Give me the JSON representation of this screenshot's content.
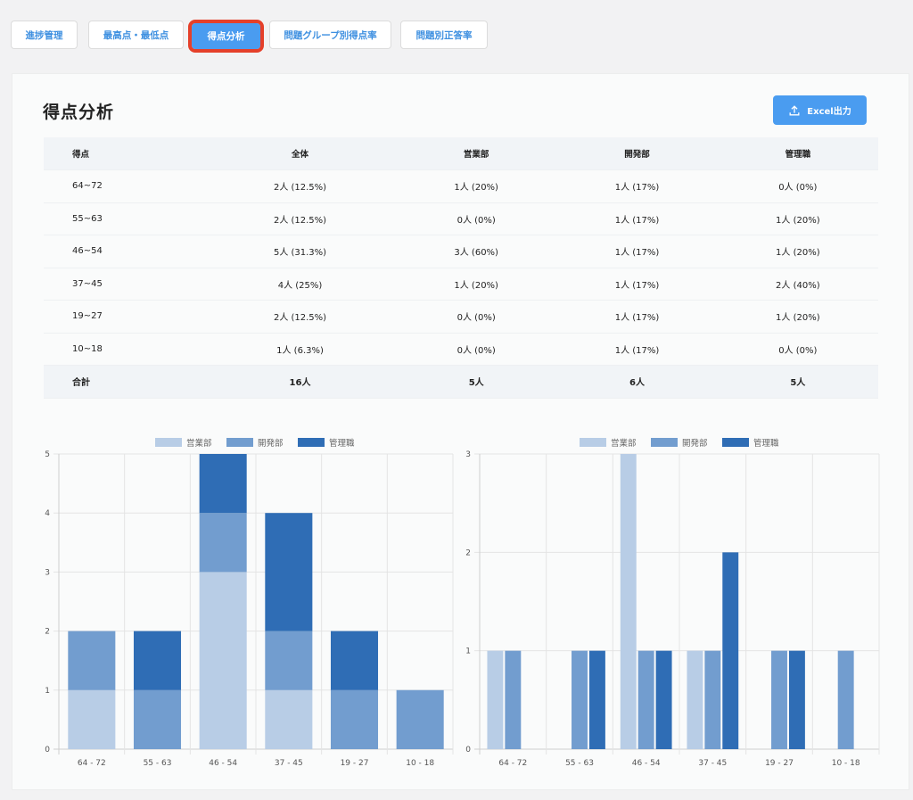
{
  "tabs": [
    {
      "label": "進捗管理"
    },
    {
      "label": "最高点・最低点"
    },
    {
      "label": "得点分析"
    },
    {
      "label": "問題グループ別得点率"
    },
    {
      "label": "問題別正答率"
    }
  ],
  "active_tab": "得点分析",
  "page": {
    "title": "得点分析",
    "excel_button": "Excel出力"
  },
  "table": {
    "headers": [
      "得点",
      "全体",
      "営業部",
      "開発部",
      "管理職"
    ],
    "rows": [
      [
        "64~72",
        "2人 (12.5%)",
        "1人 (20%)",
        "1人 (17%)",
        "0人 (0%)"
      ],
      [
        "55~63",
        "2人 (12.5%)",
        "0人 (0%)",
        "1人 (17%)",
        "1人 (20%)"
      ],
      [
        "46~54",
        "5人 (31.3%)",
        "3人 (60%)",
        "1人 (17%)",
        "1人 (20%)"
      ],
      [
        "37~45",
        "4人 (25%)",
        "1人 (20%)",
        "1人 (17%)",
        "2人 (40%)"
      ],
      [
        "19~27",
        "2人 (12.5%)",
        "0人 (0%)",
        "1人 (17%)",
        "1人 (20%)"
      ],
      [
        "10~18",
        "1人 (6.3%)",
        "0人 (0%)",
        "1人 (17%)",
        "0人 (0%)"
      ]
    ],
    "total": [
      "合計",
      "16人",
      "5人",
      "6人",
      "5人"
    ]
  },
  "colors": {
    "series": [
      "#b8cde6",
      "#729dcf",
      "#2f6db5"
    ],
    "accent": "#4a9cf0",
    "highlight": "#e5402a"
  },
  "chart_data": [
    {
      "type": "bar",
      "stacked": true,
      "categories": [
        "64 - 72",
        "55 - 63",
        "46 - 54",
        "37 - 45",
        "19 - 27",
        "10 - 18"
      ],
      "series": [
        {
          "name": "営業部",
          "values": [
            1,
            0,
            3,
            1,
            0,
            0
          ]
        },
        {
          "name": "開発部",
          "values": [
            1,
            1,
            1,
            1,
            1,
            1
          ]
        },
        {
          "name": "管理職",
          "values": [
            0,
            1,
            1,
            2,
            1,
            0
          ]
        }
      ],
      "ylim": [
        0,
        5
      ],
      "yticks": [
        "0",
        "1",
        "2",
        "3",
        "4",
        "5"
      ],
      "legend": "top",
      "grid": true
    },
    {
      "type": "bar",
      "stacked": false,
      "categories": [
        "64 - 72",
        "55 - 63",
        "46 - 54",
        "37 - 45",
        "19 - 27",
        "10 - 18"
      ],
      "series": [
        {
          "name": "営業部",
          "values": [
            1,
            0,
            3,
            1,
            0,
            0
          ]
        },
        {
          "name": "開発部",
          "values": [
            1,
            1,
            1,
            1,
            1,
            1
          ]
        },
        {
          "name": "管理職",
          "values": [
            0,
            1,
            1,
            2,
            1,
            0
          ]
        }
      ],
      "ylim": [
        0,
        3
      ],
      "yticks": [
        "0",
        "1",
        "2",
        "3"
      ],
      "legend": "top",
      "grid": true
    }
  ]
}
